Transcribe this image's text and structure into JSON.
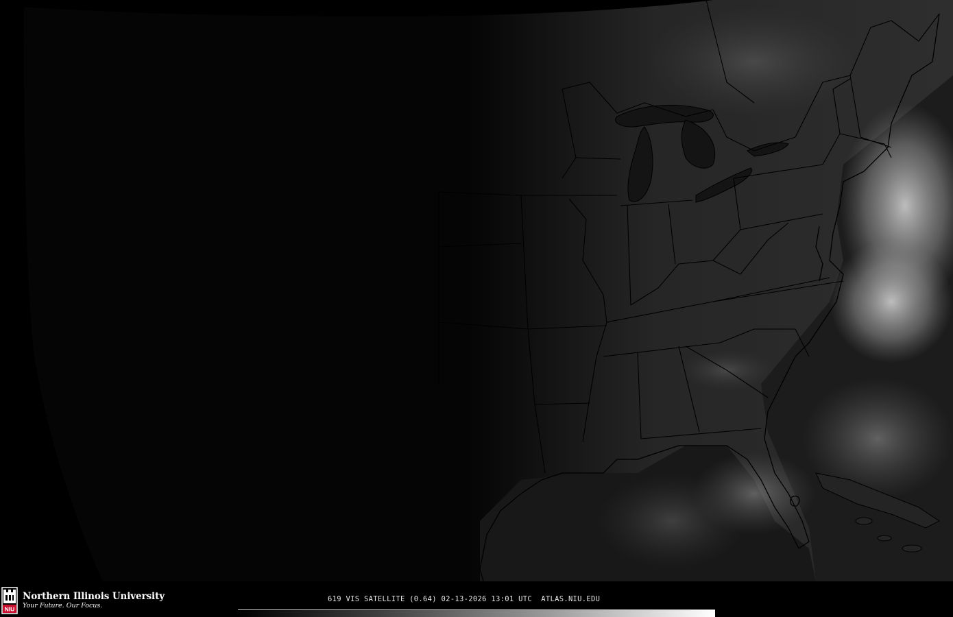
{
  "map": {
    "region": "Eastern United States",
    "product": "Visible satellite imagery",
    "colors": {
      "background": "#000000",
      "night_side": "#040404",
      "land_day": "#2c2c2c",
      "cloud": "#bdbdbd",
      "borders": "#000000"
    },
    "icons": [
      "niu-huskie-logo"
    ]
  },
  "footer": {
    "university_name": "Northern Illinois University",
    "tagline": "Your Future. Our Focus.",
    "logo_letters": "NIU",
    "caption": "619 VIS SATELLITE (0.64) 02-13-2026 13:01 UTC  ATLAS.NIU.EDU",
    "colorbar": {
      "gradient": [
        "#000000",
        "#404040",
        "#9a9a9a",
        "#ffffff"
      ]
    }
  }
}
